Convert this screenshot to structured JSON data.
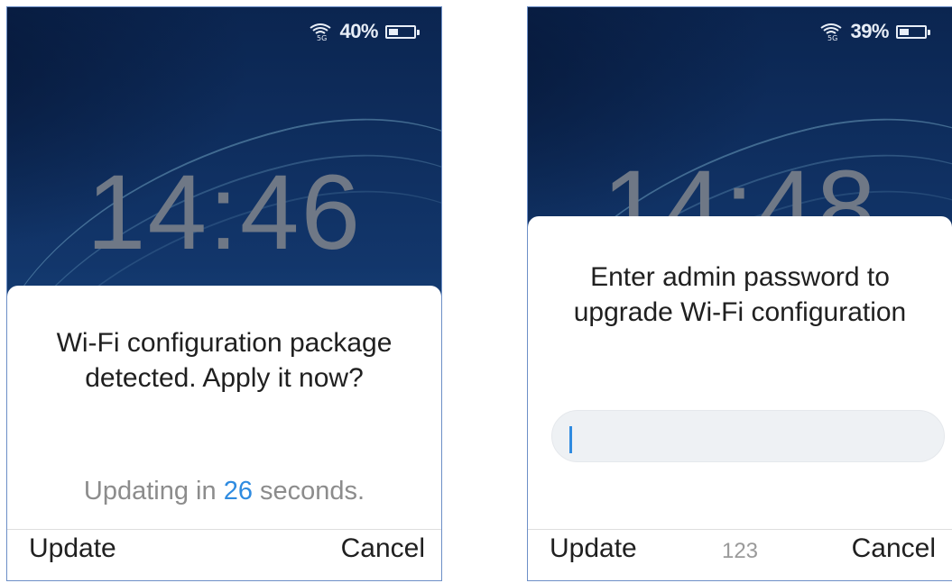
{
  "screens": [
    {
      "status": {
        "battery_percent": "40%",
        "battery_level": 0.4,
        "wifi_icon": "wifi-5g-icon",
        "wifi_band": "5G"
      },
      "clock": "14:46",
      "dialog": {
        "message": "Wi-Fi configuration package detected. Apply it now?",
        "countdown_prefix": "Updating in",
        "countdown_value": "26",
        "countdown_suffix": "seconds."
      },
      "softkeys": {
        "left": "Update",
        "right": "Cancel"
      }
    },
    {
      "status": {
        "battery_percent": "39%",
        "battery_level": 0.39,
        "wifi_icon": "wifi-5g-icon",
        "wifi_band": "5G"
      },
      "clock": "14:48",
      "dialog": {
        "message": "Enter admin password to upgrade Wi-Fi configuration",
        "password_value": ""
      },
      "softkeys": {
        "left": "Update",
        "center": "123",
        "right": "Cancel"
      }
    }
  ],
  "colors": {
    "accent": "#2f8be0",
    "countdown_text": "#8c8c8c",
    "clock": "#6f7886"
  }
}
